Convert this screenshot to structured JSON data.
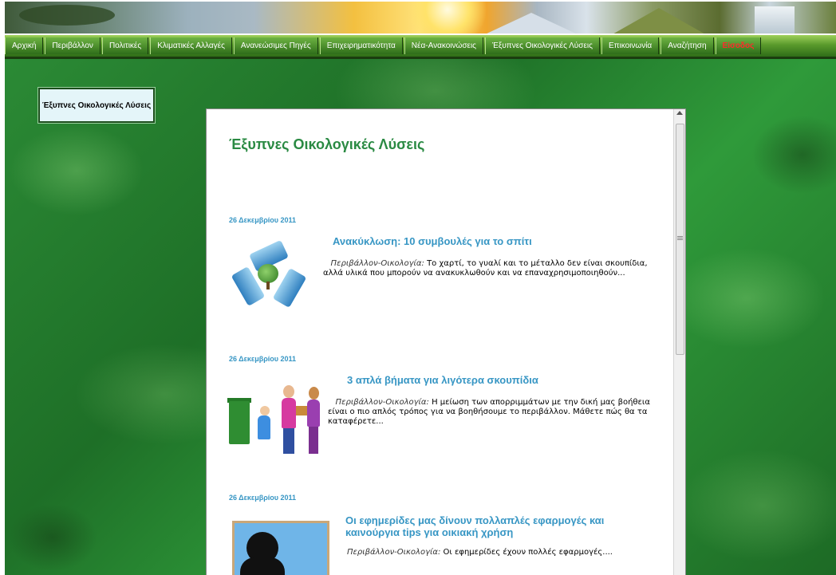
{
  "nav": {
    "items": [
      {
        "label": "Αρχική"
      },
      {
        "label": "Περιβάλλον"
      },
      {
        "label": "Πολιτικές"
      },
      {
        "label": "Κλιματικές Αλλαγές"
      },
      {
        "label": "Ανανεώσιμες Πηγές"
      },
      {
        "label": "Επιχειρηματικότητα"
      },
      {
        "label": "Νέα-Ανακοινώσεις"
      },
      {
        "label": "Έξυπνες Οικολογικές Λύσεις"
      },
      {
        "label": "Επικοινωνία"
      },
      {
        "label": "Αναζήτηση"
      },
      {
        "label": "Είσοδος"
      }
    ],
    "active_color": "#ff2a2a"
  },
  "sidebar": {
    "box_label": "Έξυπνες Οικολογικές Λύσεις"
  },
  "main": {
    "title": "Έξυπνες Οικολογικές Λύσεις",
    "posts": [
      {
        "date": "26 Δεκεμβρίου 2011",
        "title": "Ανακύκλωση: 10 συμβουλές για το σπίτι",
        "category": "Περιβάλλον-Οικολογία:",
        "excerpt": " Το χαρτί, το γυαλί και το μέταλλο δεν είναι σκουπίδια, αλλά υλικά που μπορούν να ανακυκλωθούν και να επαναχρησιμοποιηθούν...",
        "icon": "recycle-icon"
      },
      {
        "date": "26 Δεκεμβρίου 2011",
        "title": "3 απλά βήματα για λιγότερα σκουπίδια",
        "category": "Περιβάλλον-Οικολογία:",
        "excerpt": " Η μείωση των απορριμμάτων με την δική μας βοήθεια είναι ο πιο απλός τρόπος για να βοηθήσουμε το περιβάλλον. Μάθετε πώς θα τα καταφέρετε...",
        "icon": "recycling-family-icon"
      },
      {
        "date": "26 Δεκεμβρίου 2011",
        "title": "Οι εφημερίδες μας δίνουν πολλαπλές εφαρμογές και καινούργια tips για οικιακή χρήση",
        "category": "Περιβάλλον-Οικολογία:",
        "excerpt": " Οι εφημερίδες έχουν πολλές εφαρμογές....",
        "icon": "window-cleaning-icon"
      }
    ]
  },
  "colors": {
    "title_green": "#2a8a43",
    "link_blue": "#3796c4"
  }
}
